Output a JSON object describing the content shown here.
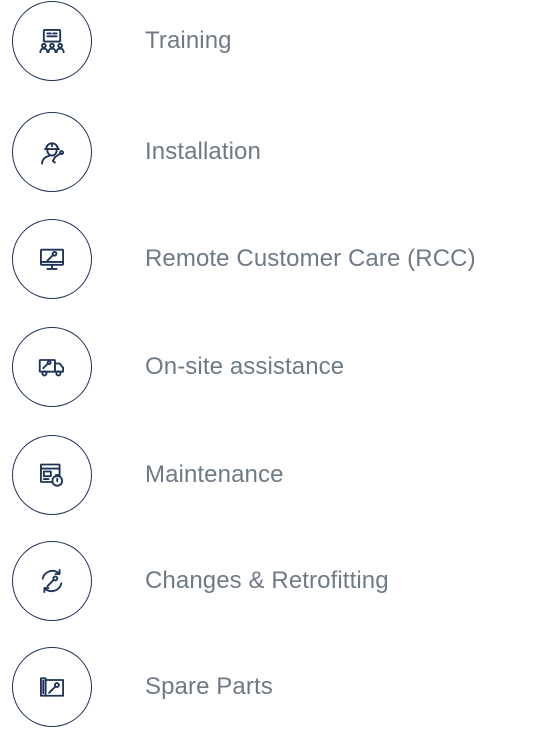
{
  "services": [
    {
      "label": "Training",
      "icon": "training-icon"
    },
    {
      "label": "Installation",
      "icon": "technician-wrench-icon"
    },
    {
      "label": "Remote Customer Care (RCC)",
      "icon": "monitor-wrench-icon"
    },
    {
      "label": "On-site assistance",
      "icon": "service-truck-icon"
    },
    {
      "label": "Maintenance",
      "icon": "maintenance-stopwatch-icon"
    },
    {
      "label": "Changes & Retrofitting",
      "icon": "retrofit-cycle-wrench-icon"
    },
    {
      "label": "Spare Parts",
      "icon": "spare-parts-map-icon"
    }
  ],
  "colors": {
    "icon_stroke": "#1f3358",
    "label_text": "#6f7a86",
    "background": "#ffffff"
  }
}
